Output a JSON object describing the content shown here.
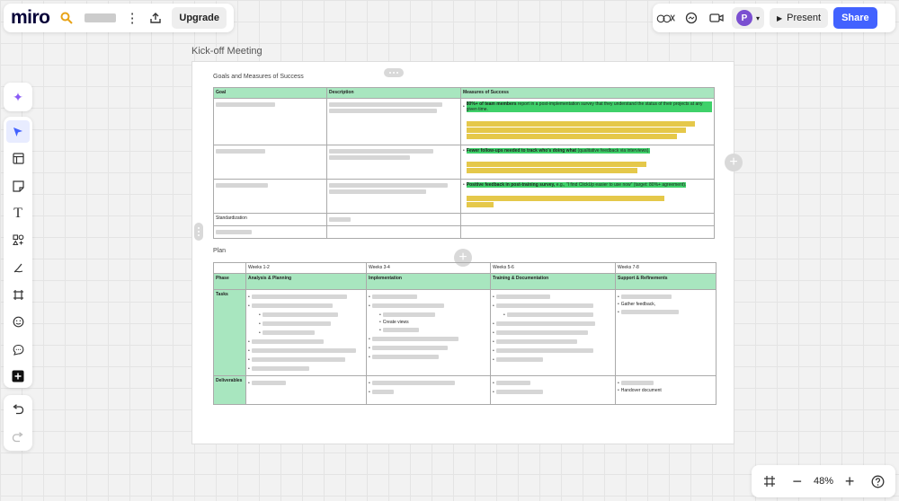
{
  "app": {
    "logo": "miro",
    "upgrade_label": "Upgrade"
  },
  "topright": {
    "avatar_initial": "P",
    "present_label": "Present",
    "share_label": "Share"
  },
  "zoom": {
    "value": "48%"
  },
  "frame": {
    "title": "Kick-off Meeting"
  },
  "goals": {
    "label": "Goals and Measures of Success",
    "headers": [
      "Goal",
      "Description",
      "Measures of Success"
    ],
    "row1_measure_bold": "80%+ of team members",
    "row1_measure_rest": " report in a post-implementation survey that they understand the status of their projects at any given time.",
    "row2_measure_bold": "Fewer follow-ups needed to track who's doing what",
    "row2_measure_rest": " (qualitative feedback via interviews).",
    "row3_measure_bold": "Positive feedback in post-training survey,",
    "row3_measure_rest": " e.g., \"I find ClickUp easier to use now\" (target: 80%+ agreement).",
    "row4_goal": "Standardization"
  },
  "plan": {
    "label": "Plan",
    "weeks": [
      "Weeks 1-2",
      "Weeks 3-4",
      "Weeks 5-6",
      "Weeks 7-8"
    ],
    "phase_label": "Phase",
    "phases": [
      "Analysis & Planning",
      "Implementation",
      "Training & Documentation",
      "Support & Refinements"
    ],
    "tasks_label": "Tasks",
    "deliverables_label": "Deliverables",
    "impl_task_create_views": "Create views",
    "support_task_feedback": "Gather feedback,",
    "support_deliverable_handover": "Handover document"
  },
  "colors": {
    "accent": "#4262ff",
    "table_header_green": "#a8e6bf",
    "highlight_green": "#3fd16a",
    "highlight_yellow": "#e5c84a"
  }
}
